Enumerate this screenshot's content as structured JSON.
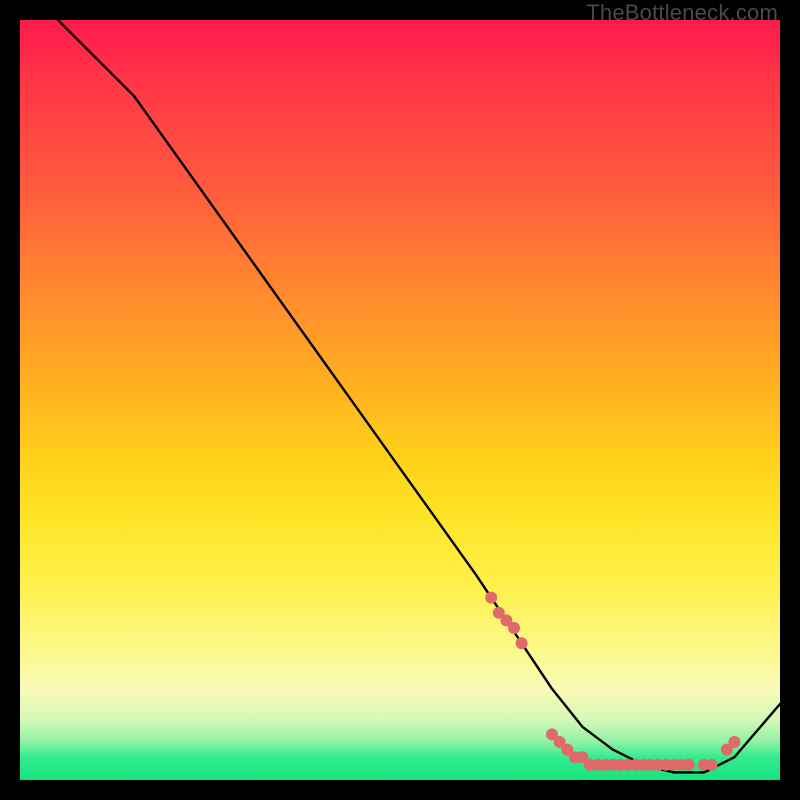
{
  "attribution": "TheBottleneck.com",
  "chart_data": {
    "type": "line",
    "title": "",
    "xlabel": "",
    "ylabel": "",
    "xlim": [
      0,
      100
    ],
    "ylim": [
      0,
      100
    ],
    "series": [
      {
        "name": "curve",
        "x": [
          5,
          10,
          15,
          20,
          25,
          30,
          35,
          40,
          45,
          50,
          55,
          60,
          62,
          66,
          70,
          74,
          78,
          82,
          86,
          90,
          94,
          100
        ],
        "y": [
          100,
          95,
          90,
          83,
          76,
          69,
          62,
          55,
          48,
          41,
          34,
          27,
          24,
          18,
          12,
          7,
          4,
          2,
          1,
          1,
          3,
          10
        ]
      }
    ],
    "markers": {
      "name": "flat-region-dots",
      "color": "#e06a6a",
      "x": [
        62,
        63,
        64,
        65,
        66,
        70,
        71,
        72,
        73,
        74,
        75,
        76,
        77,
        78,
        79,
        80,
        81,
        82,
        83,
        84,
        85,
        86,
        87,
        88,
        90,
        91,
        93,
        94
      ],
      "y": [
        24,
        22,
        21,
        20,
        18,
        6,
        5,
        4,
        3,
        3,
        2,
        2,
        2,
        2,
        2,
        2,
        2,
        2,
        2,
        2,
        2,
        2,
        2,
        2,
        2,
        2,
        4,
        5
      ]
    }
  }
}
